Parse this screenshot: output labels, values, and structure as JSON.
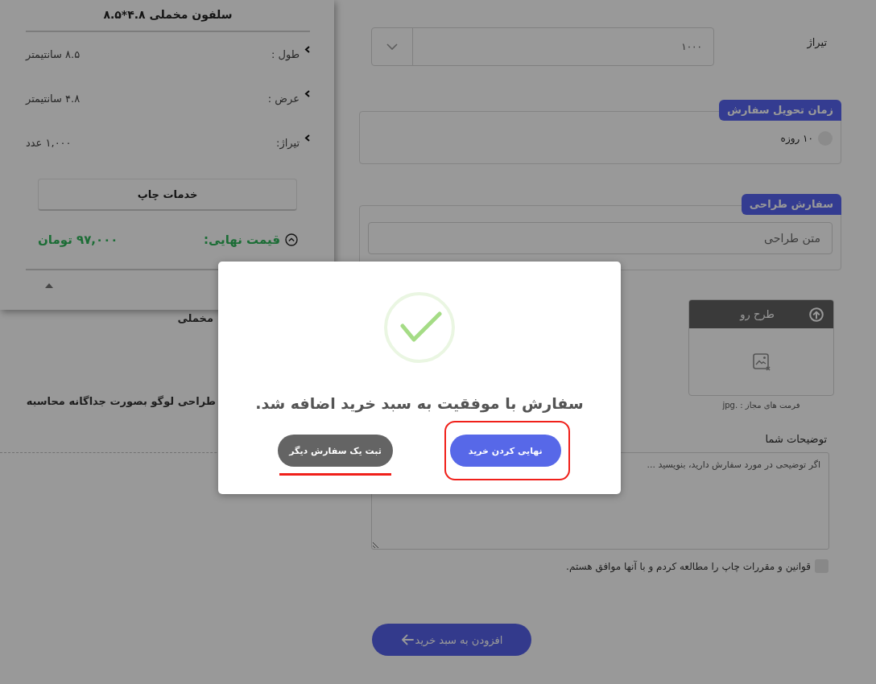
{
  "summary": {
    "title": "سلفون مخملی ۴.۸*۸.۵",
    "specs": [
      {
        "label": "طول :",
        "value": "۸.۵ سانتیمتر"
      },
      {
        "label": "عرض :",
        "value": "۴.۸ سانتیمتر"
      },
      {
        "label": "تیراژ:",
        "value": "۱,۰۰۰ عدد"
      }
    ],
    "services_button": "خدمات چاپ",
    "price": {
      "label": "قیمت نهایی:",
      "value": "۹۷,۰۰۰ تومان"
    }
  },
  "page_notes": [
    "مخملی",
    "طراحی لوگو بصورت جداگانه محاسبه"
  ],
  "form": {
    "quantity": {
      "label": "تیراژ",
      "value": "۱۰۰۰"
    },
    "delivery": {
      "title": "زمان تحویل سفارش",
      "options": [
        {
          "label": "۱۰ روزه",
          "selected": false
        }
      ]
    },
    "design": {
      "title": "سفارش طراحی",
      "placeholder": "متن طراحی"
    },
    "upload": {
      "title": "طرح رو",
      "formats": "فرمت های مجاز : .jpg"
    },
    "notes": {
      "label": "توضیحات شما",
      "placeholder": "اگر توضیحی در مورد سفارش دارید، بنویسید ..."
    },
    "terms": {
      "label": "قوانین و مقررات چاپ را مطالعه کردم و با آنها موافق هستم.",
      "checked": false
    },
    "submit": "افزودن به سبد خرید"
  },
  "dialog": {
    "title": "سفارش با موفقیت به سبد خرید اضافه شد.",
    "buttons": [
      {
        "label": "نهایی کردن خرید",
        "kind": "primary",
        "circled": true,
        "underlined": false
      },
      {
        "label": "ثبت یک سفارش دیگر",
        "kind": "secondary",
        "circled": false,
        "underlined": true
      }
    ]
  }
}
